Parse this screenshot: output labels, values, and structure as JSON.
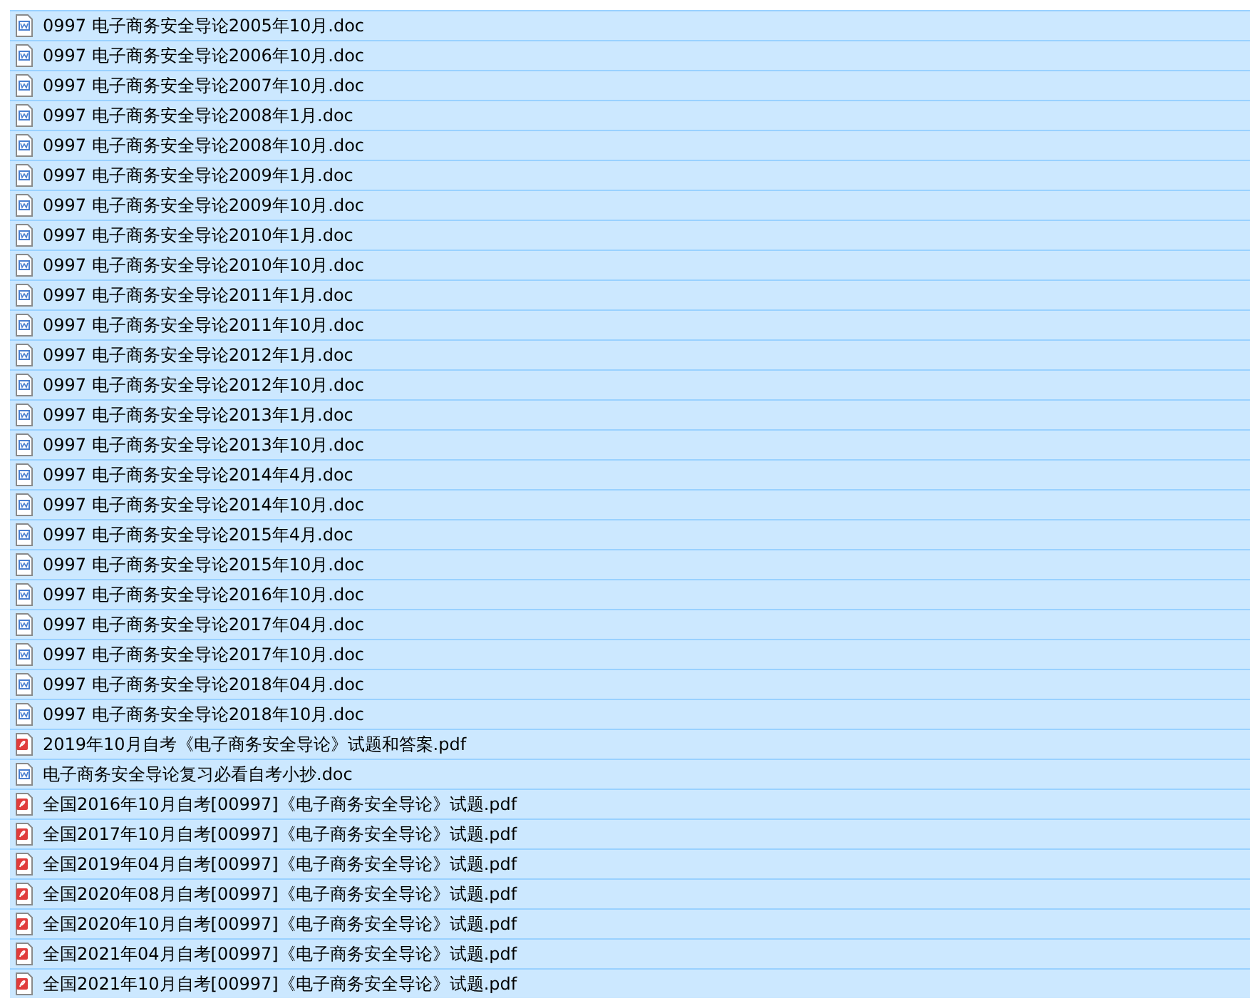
{
  "files": [
    {
      "name": "0997 电子商务安全导论2005年10月.doc",
      "kind": "doc",
      "selected": true
    },
    {
      "name": "0997 电子商务安全导论2006年10月.doc",
      "kind": "doc",
      "selected": true
    },
    {
      "name": "0997 电子商务安全导论2007年10月.doc",
      "kind": "doc",
      "selected": true
    },
    {
      "name": "0997 电子商务安全导论2008年1月.doc",
      "kind": "doc",
      "selected": true
    },
    {
      "name": "0997 电子商务安全导论2008年10月.doc",
      "kind": "doc",
      "selected": true
    },
    {
      "name": "0997 电子商务安全导论2009年1月.doc",
      "kind": "doc",
      "selected": true
    },
    {
      "name": "0997 电子商务安全导论2009年10月.doc",
      "kind": "doc",
      "selected": true
    },
    {
      "name": "0997 电子商务安全导论2010年1月.doc",
      "kind": "doc",
      "selected": true
    },
    {
      "name": "0997 电子商务安全导论2010年10月.doc",
      "kind": "doc",
      "selected": true
    },
    {
      "name": "0997 电子商务安全导论2011年1月.doc",
      "kind": "doc",
      "selected": true
    },
    {
      "name": "0997 电子商务安全导论2011年10月.doc",
      "kind": "doc",
      "selected": true
    },
    {
      "name": "0997 电子商务安全导论2012年1月.doc",
      "kind": "doc",
      "selected": true
    },
    {
      "name": "0997 电子商务安全导论2012年10月.doc",
      "kind": "doc",
      "selected": true
    },
    {
      "name": "0997 电子商务安全导论2013年1月.doc",
      "kind": "doc",
      "selected": true
    },
    {
      "name": "0997 电子商务安全导论2013年10月.doc",
      "kind": "doc",
      "selected": true
    },
    {
      "name": "0997 电子商务安全导论2014年4月.doc",
      "kind": "doc",
      "selected": true
    },
    {
      "name": "0997 电子商务安全导论2014年10月.doc",
      "kind": "doc",
      "selected": true
    },
    {
      "name": "0997 电子商务安全导论2015年4月.doc",
      "kind": "doc",
      "selected": true
    },
    {
      "name": "0997 电子商务安全导论2015年10月.doc",
      "kind": "doc",
      "selected": true
    },
    {
      "name": "0997 电子商务安全导论2016年10月.doc",
      "kind": "doc",
      "selected": true
    },
    {
      "name": "0997 电子商务安全导论2017年04月.doc",
      "kind": "doc",
      "selected": true
    },
    {
      "name": "0997 电子商务安全导论2017年10月.doc",
      "kind": "doc",
      "selected": true
    },
    {
      "name": "0997 电子商务安全导论2018年04月.doc",
      "kind": "doc",
      "selected": true
    },
    {
      "name": "0997 电子商务安全导论2018年10月.doc",
      "kind": "doc",
      "selected": true
    },
    {
      "name": "2019年10月自考《电子商务安全导论》试题和答案.pdf",
      "kind": "pdf",
      "selected": true
    },
    {
      "name": "电子商务安全导论复习必看自考小抄.doc",
      "kind": "doc",
      "selected": true
    },
    {
      "name": "全国2016年10月自考[00997]《电子商务安全导论》试题.pdf",
      "kind": "pdf",
      "selected": true
    },
    {
      "name": "全国2017年10月自考[00997]《电子商务安全导论》试题.pdf",
      "kind": "pdf",
      "selected": true
    },
    {
      "name": "全国2019年04月自考[00997]《电子商务安全导论》试题.pdf",
      "kind": "pdf",
      "selected": true
    },
    {
      "name": "全国2020年08月自考[00997]《电子商务安全导论》试题.pdf",
      "kind": "pdf",
      "selected": true
    },
    {
      "name": "全国2020年10月自考[00997]《电子商务安全导论》试题.pdf",
      "kind": "pdf",
      "selected": true
    },
    {
      "name": "全国2021年04月自考[00997]《电子商务安全导论》试题.pdf",
      "kind": "pdf",
      "selected": true
    },
    {
      "name": "全国2021年10月自考[00997]《电子商务安全导论》试题.pdf",
      "kind": "pdf",
      "selected": true
    }
  ]
}
